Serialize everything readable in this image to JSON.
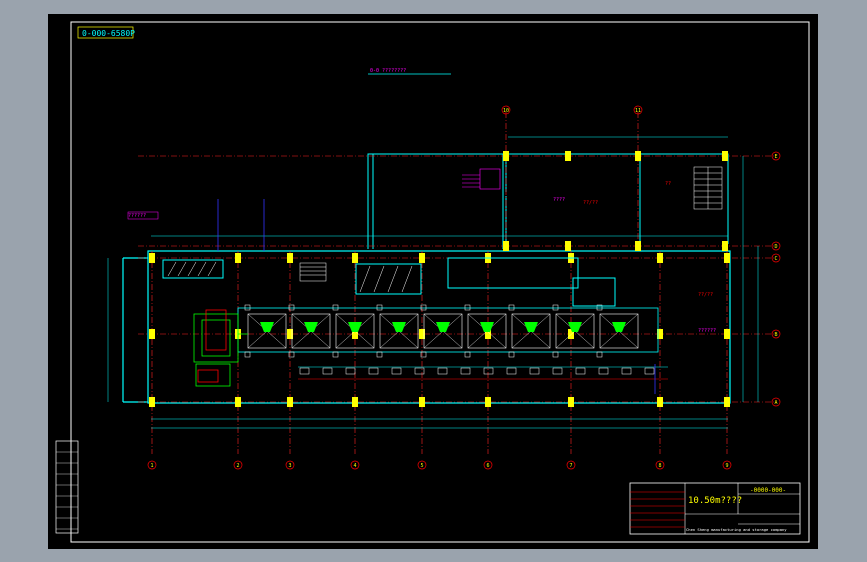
{
  "drawing": {
    "code_tag": "0-000-6580P",
    "section_title": "0-0 ????????",
    "title_block": {
      "title": "10.50m????",
      "code": "-0000-000-",
      "rows": [
        "",
        "",
        "",
        "",
        "",
        ""
      ],
      "footer": "Chen Sheng manufacturing and storage company"
    },
    "revision_table": [
      "",
      "",
      "",
      "",
      "",
      "",
      "",
      ""
    ]
  },
  "grid": {
    "columns": [
      "1",
      "2",
      "3",
      "4",
      "5",
      "6",
      "7",
      "8",
      "9"
    ],
    "rows": [
      "A",
      "B",
      "C",
      "D",
      "E"
    ],
    "upper_columns": [
      "10",
      "11"
    ]
  },
  "annotations": {
    "room_label_1": "????",
    "room_label_2": "??/??",
    "room_label_3": "??",
    "room_label_4": "??/??",
    "left_tag": "??????",
    "right_tag": "??????"
  },
  "colors": {
    "background": "#000000",
    "frame": "#ffffff",
    "wall": "#00ffff",
    "grid": "#ff2020",
    "column": "#ffff00",
    "equipment": "#00ff00",
    "text": "#ffff00",
    "magenta": "#ff00ff"
  }
}
